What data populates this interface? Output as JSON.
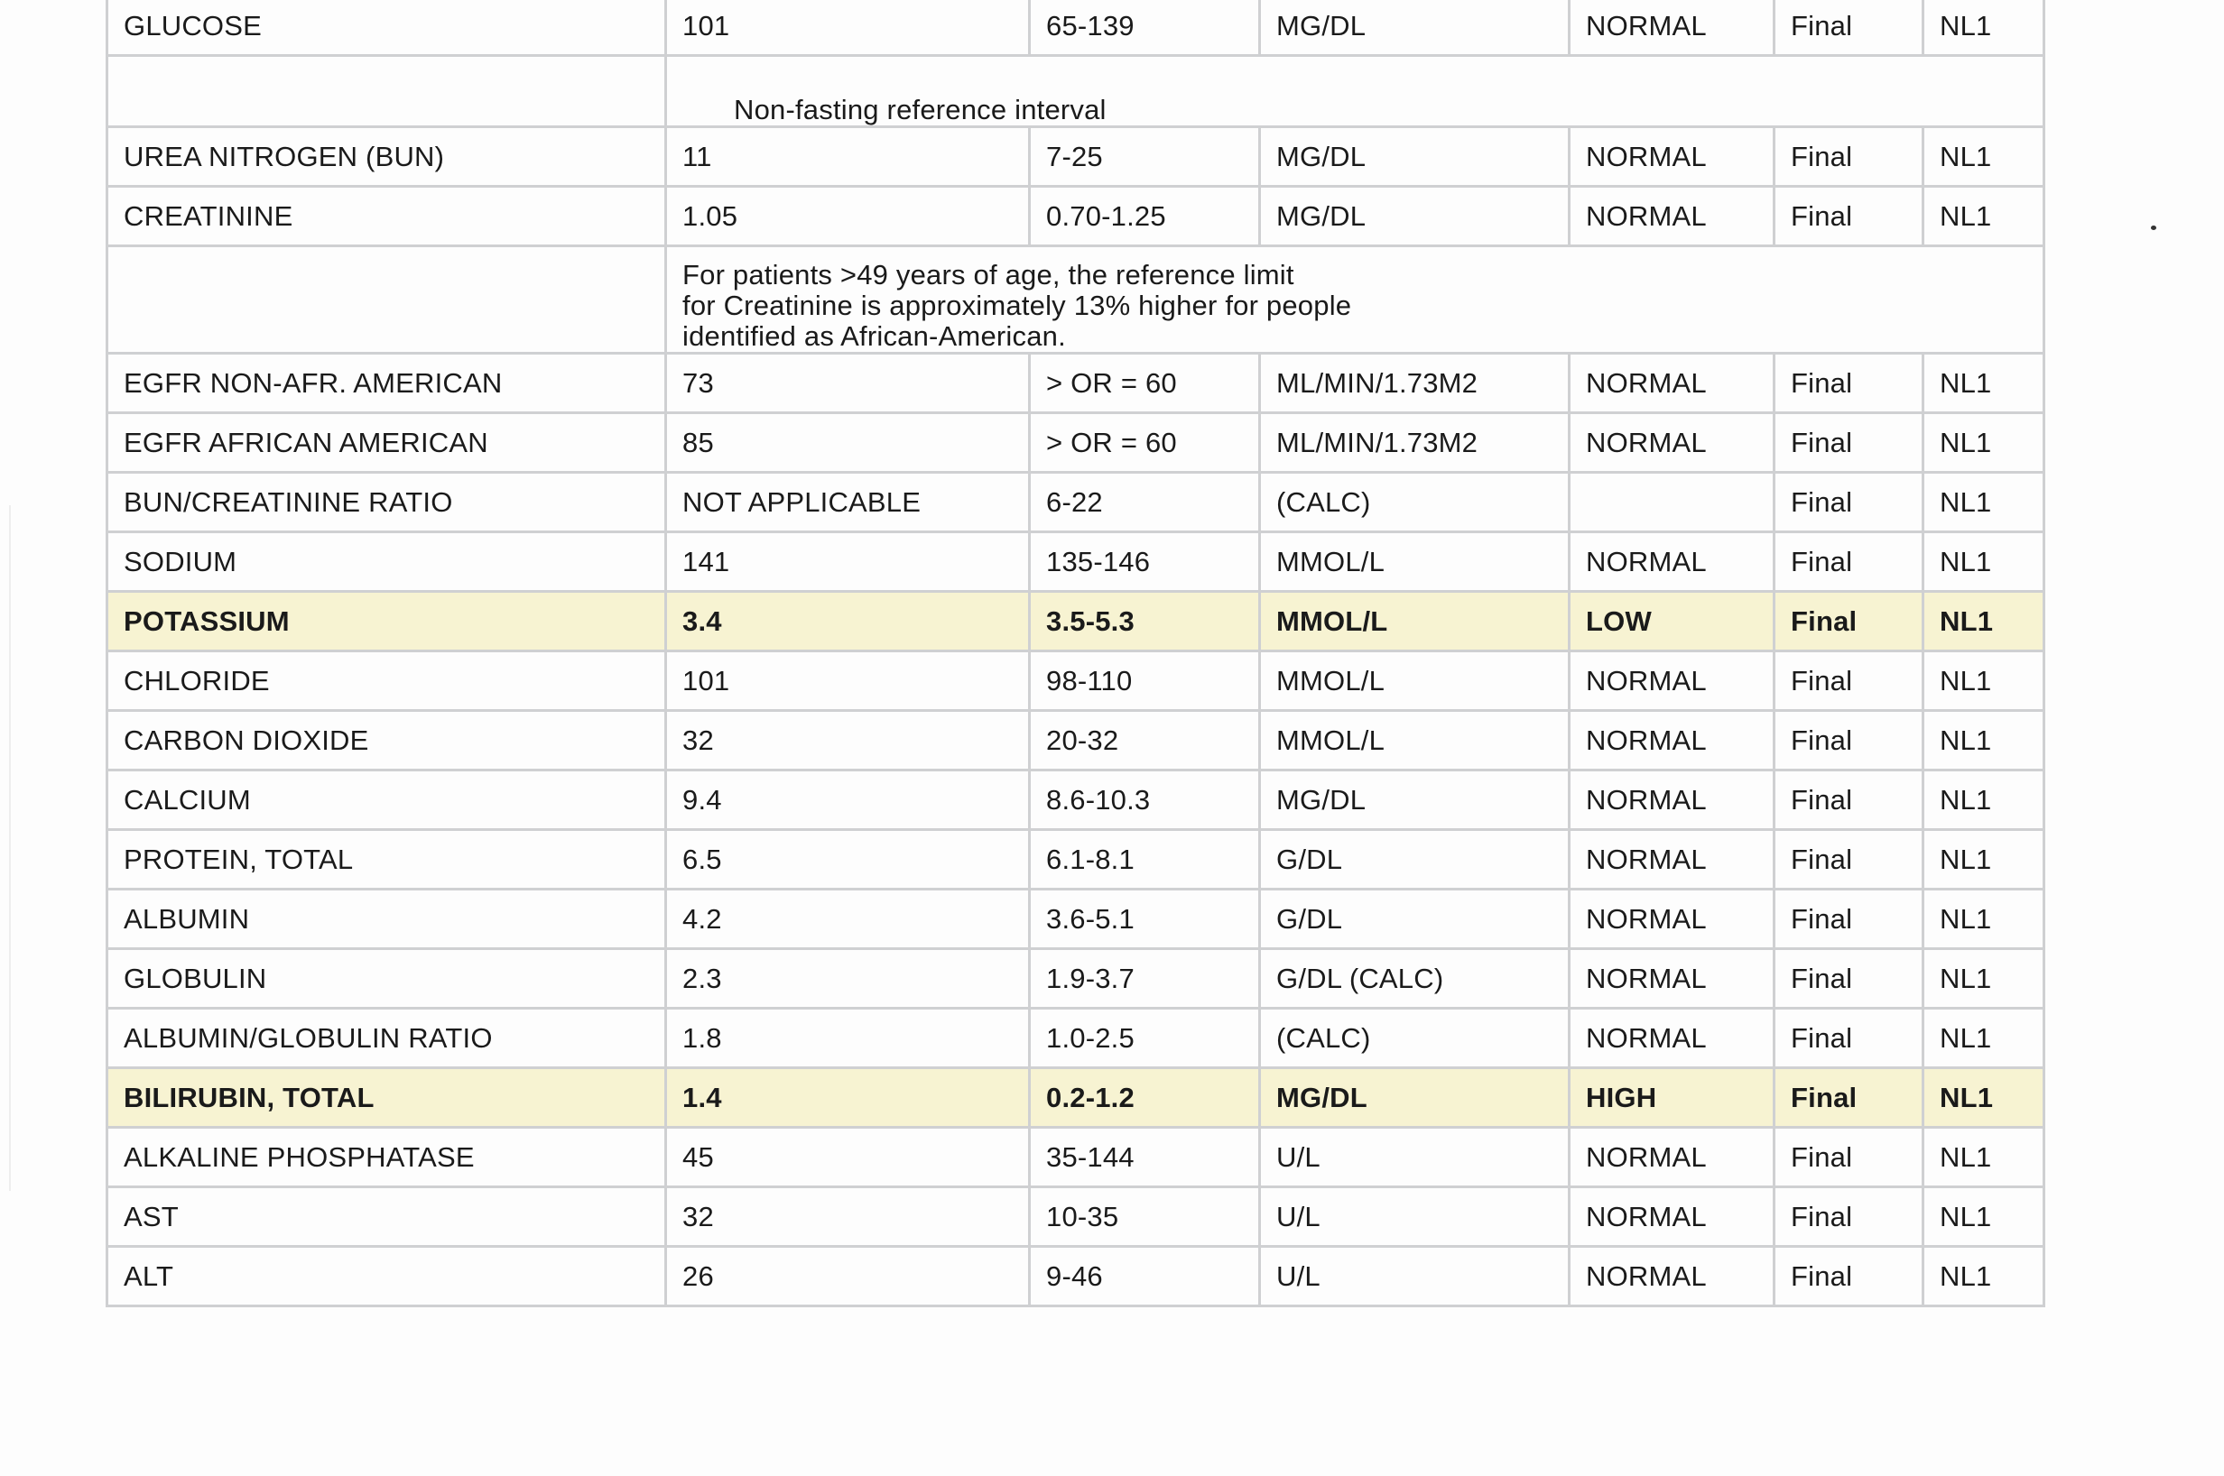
{
  "report": {
    "rows": [
      {
        "kind": "result",
        "test": "GLUCOSE",
        "value": "101",
        "range": "65-139",
        "units": "MG/DL",
        "flag": "NORMAL",
        "status": "Final",
        "lab": "NL1"
      },
      {
        "kind": "note",
        "style": "short",
        "text": "Non-fasting reference interval"
      },
      {
        "kind": "result",
        "test": "UREA NITROGEN (BUN)",
        "value": "11",
        "range": "7-25",
        "units": "MG/DL",
        "flag": "NORMAL",
        "status": "Final",
        "lab": "NL1"
      },
      {
        "kind": "result",
        "test": "CREATININE",
        "value": "1.05",
        "range": "0.70-1.25",
        "units": "MG/DL",
        "flag": "NORMAL",
        "status": "Final",
        "lab": "NL1"
      },
      {
        "kind": "note",
        "style": "long",
        "text": "For patients >49 years of age, the reference limit\nfor Creatinine is approximately 13% higher for people\nidentified as African-American."
      },
      {
        "kind": "result",
        "test": "EGFR NON-AFR. AMERICAN",
        "value": "73",
        "range": "> OR = 60",
        "units": "ML/MIN/1.73M2",
        "flag": "NORMAL",
        "status": "Final",
        "lab": "NL1"
      },
      {
        "kind": "result",
        "test": "EGFR AFRICAN AMERICAN",
        "value": "85",
        "range": "> OR = 60",
        "units": "ML/MIN/1.73M2",
        "flag": "NORMAL",
        "status": "Final",
        "lab": "NL1"
      },
      {
        "kind": "result",
        "test": "BUN/CREATININE RATIO",
        "value": "NOT APPLICABLE",
        "range": "6-22",
        "units": "(CALC)",
        "flag": "",
        "status": "Final",
        "lab": "NL1"
      },
      {
        "kind": "result",
        "test": "SODIUM",
        "value": "141",
        "range": "135-146",
        "units": "MMOL/L",
        "flag": "NORMAL",
        "status": "Final",
        "lab": "NL1"
      },
      {
        "kind": "result",
        "test": "POTASSIUM",
        "value": "3.4",
        "range": "3.5-5.3",
        "units": "MMOL/L",
        "flag": "LOW",
        "status": "Final",
        "lab": "NL1",
        "abnormal": true
      },
      {
        "kind": "result",
        "test": "CHLORIDE",
        "value": "101",
        "range": "98-110",
        "units": "MMOL/L",
        "flag": "NORMAL",
        "status": "Final",
        "lab": "NL1"
      },
      {
        "kind": "result",
        "test": "CARBON DIOXIDE",
        "value": "32",
        "range": "20-32",
        "units": "MMOL/L",
        "flag": "NORMAL",
        "status": "Final",
        "lab": "NL1"
      },
      {
        "kind": "result",
        "test": "CALCIUM",
        "value": "9.4",
        "range": "8.6-10.3",
        "units": "MG/DL",
        "flag": "NORMAL",
        "status": "Final",
        "lab": "NL1"
      },
      {
        "kind": "result",
        "test": "PROTEIN, TOTAL",
        "value": "6.5",
        "range": "6.1-8.1",
        "units": "G/DL",
        "flag": "NORMAL",
        "status": "Final",
        "lab": "NL1"
      },
      {
        "kind": "result",
        "test": "ALBUMIN",
        "value": "4.2",
        "range": "3.6-5.1",
        "units": "G/DL",
        "flag": "NORMAL",
        "status": "Final",
        "lab": "NL1"
      },
      {
        "kind": "result",
        "test": "GLOBULIN",
        "value": "2.3",
        "range": "1.9-3.7",
        "units": "G/DL (CALC)",
        "flag": "NORMAL",
        "status": "Final",
        "lab": "NL1"
      },
      {
        "kind": "result",
        "test": "ALBUMIN/GLOBULIN RATIO",
        "value": "1.8",
        "range": "1.0-2.5",
        "units": "(CALC)",
        "flag": "NORMAL",
        "status": "Final",
        "lab": "NL1"
      },
      {
        "kind": "result",
        "test": "BILIRUBIN, TOTAL",
        "value": "1.4",
        "range": "0.2-1.2",
        "units": "MG/DL",
        "flag": "HIGH",
        "status": "Final",
        "lab": "NL1",
        "abnormal": true
      },
      {
        "kind": "result",
        "test": "ALKALINE PHOSPHATASE",
        "value": "45",
        "range": "35-144",
        "units": "U/L",
        "flag": "NORMAL",
        "status": "Final",
        "lab": "NL1"
      },
      {
        "kind": "result",
        "test": "AST",
        "value": "32",
        "range": "10-35",
        "units": "U/L",
        "flag": "NORMAL",
        "status": "Final",
        "lab": "NL1"
      },
      {
        "kind": "result",
        "test": "ALT",
        "value": "26",
        "range": "9-46",
        "units": "U/L",
        "flag": "NORMAL",
        "status": "Final",
        "lab": "NL1"
      }
    ]
  },
  "colors": {
    "grid_line": "#cfd0d2",
    "abnormal_highlight": "#f7f3d2",
    "text": "#1a1a1a"
  }
}
